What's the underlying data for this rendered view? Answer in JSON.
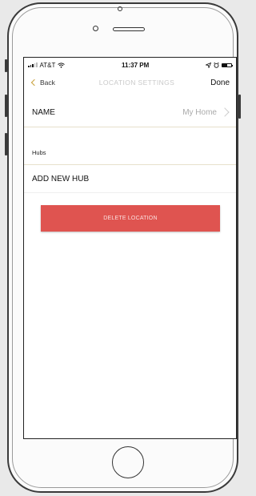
{
  "status_bar": {
    "carrier": "AT&T",
    "time": "11:37 PM"
  },
  "nav": {
    "back_label": "Back",
    "title": "LOCATION SETTINGS",
    "done_label": "Done"
  },
  "settings": {
    "name_label": "NAME",
    "name_value": "My Home",
    "hubs_header": "Hubs",
    "add_hub_label": "ADD NEW HUB",
    "delete_label": "DELETE LOCATION"
  },
  "colors": {
    "delete_button": "#df5450",
    "back_chevron": "#c9a13d"
  }
}
